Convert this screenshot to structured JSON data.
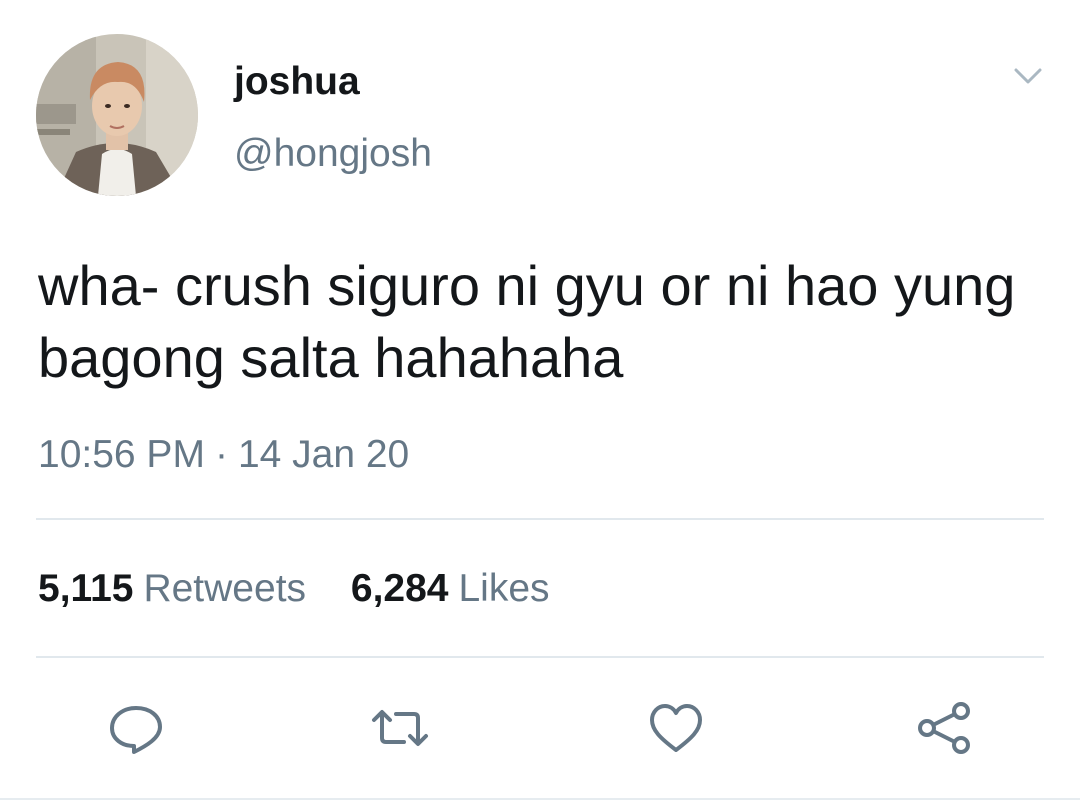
{
  "author": {
    "display_name": "joshua",
    "handle": "@hongjosh"
  },
  "tweet": {
    "text": "wha- crush siguro ni gyu or ni hao yung bagong salta hahahaha",
    "time": "10:56 PM",
    "separator": "·",
    "date": "14 Jan 20"
  },
  "stats": {
    "retweets_count": "5,115",
    "retweets_label": "Retweets",
    "likes_count": "6,284",
    "likes_label": "Likes"
  },
  "icons": {
    "caret": "chevron-down-icon",
    "reply": "reply-icon",
    "retweet": "retweet-icon",
    "like": "heart-icon",
    "share": "share-icon"
  },
  "colors": {
    "text": "#14171a",
    "secondary": "#657786",
    "divider": "#e1e8ed"
  }
}
